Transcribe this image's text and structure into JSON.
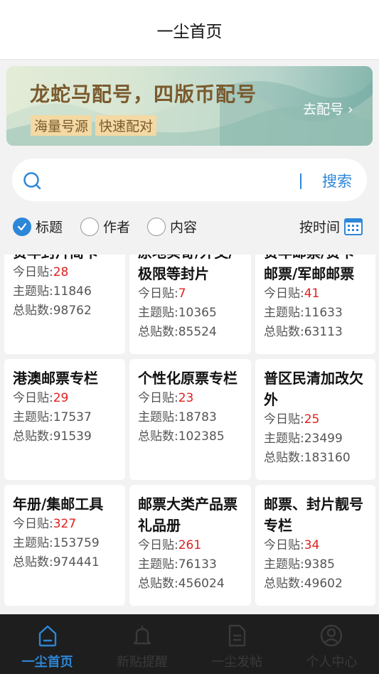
{
  "header": {
    "title": "一尘首页"
  },
  "banner": {
    "headline": "龙蛇马配号，四版币配号",
    "tags": [
      "海量号源",
      "快速配对"
    ],
    "action": "去配号 ›"
  },
  "search": {
    "placeholder": "",
    "button": "搜索"
  },
  "filters": {
    "options": [
      {
        "label": "标题",
        "checked": true
      },
      {
        "label": "作者",
        "checked": false
      },
      {
        "label": "内容",
        "checked": false
      }
    ],
    "sort_label": "按时间"
  },
  "labels": {
    "today": "今日贴:",
    "topics": "主题贴:",
    "total": "总贴数:"
  },
  "boards": [
    {
      "name": "贺年封片简卡",
      "today": "28",
      "topics": "11846",
      "total": "98762"
    },
    {
      "name": "原地实寄/外交/极限等封片",
      "today": "7",
      "topics": "10365",
      "total": "85524"
    },
    {
      "name": "贺年邮票/贺卡邮票/军邮邮票",
      "today": "41",
      "topics": "11633",
      "total": "63113"
    },
    {
      "name": "港澳邮票专栏",
      "today": "29",
      "topics": "17537",
      "total": "91539"
    },
    {
      "name": "个性化原票专栏",
      "today": "23",
      "topics": "18783",
      "total": "102385"
    },
    {
      "name": "普区民清加改欠外",
      "today": "25",
      "topics": "23499",
      "total": "183160"
    },
    {
      "name": "年册/集邮工具",
      "today": "327",
      "topics": "153759",
      "total": "974441"
    },
    {
      "name": "邮票大类产品票礼品册",
      "today": "261",
      "topics": "76133",
      "total": "456024"
    },
    {
      "name": "邮票、封片靓号专栏",
      "today": "34",
      "topics": "9385",
      "total": "49602"
    }
  ],
  "tabbar": [
    {
      "label": "一尘首页",
      "icon": "home-icon",
      "active": true
    },
    {
      "label": "新贴提醒",
      "icon": "bell-icon",
      "active": false
    },
    {
      "label": "一尘发帖",
      "icon": "document-icon",
      "active": false
    },
    {
      "label": "个人中心",
      "icon": "user-icon",
      "active": false
    }
  ],
  "colors": {
    "accent": "#2d87d8",
    "highlight": "#e02020",
    "tabbar_bg": "#1e1e1e"
  }
}
